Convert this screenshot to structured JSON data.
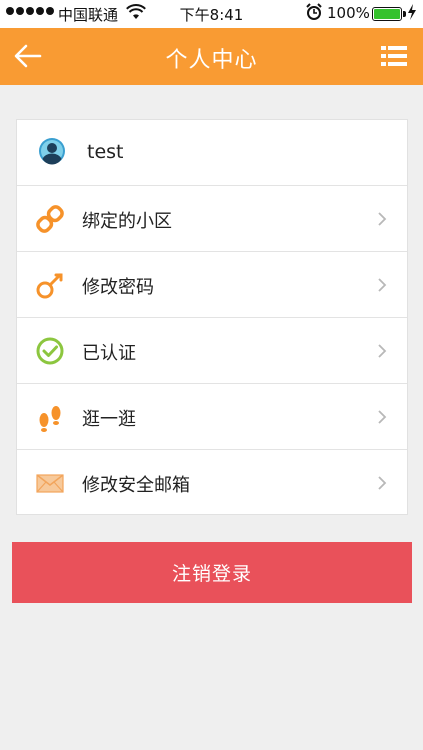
{
  "status_bar": {
    "carrier": "中国联通",
    "time": "下午8:41",
    "battery_percent": "100%"
  },
  "header": {
    "title": "个人中心"
  },
  "profile": {
    "username": "test"
  },
  "menu_items": [
    {
      "label": "绑定的小区",
      "icon": "link-icon"
    },
    {
      "label": "修改密码",
      "icon": "key-icon"
    },
    {
      "label": "已认证",
      "icon": "check-circle-icon"
    },
    {
      "label": "逛一逛",
      "icon": "footprints-icon"
    },
    {
      "label": "修改安全邮箱",
      "icon": "envelope-icon"
    }
  ],
  "logout_label": "注销登录",
  "colors": {
    "accent": "#f99b33",
    "logout": "#e9515a",
    "battery": "#35c22e"
  }
}
